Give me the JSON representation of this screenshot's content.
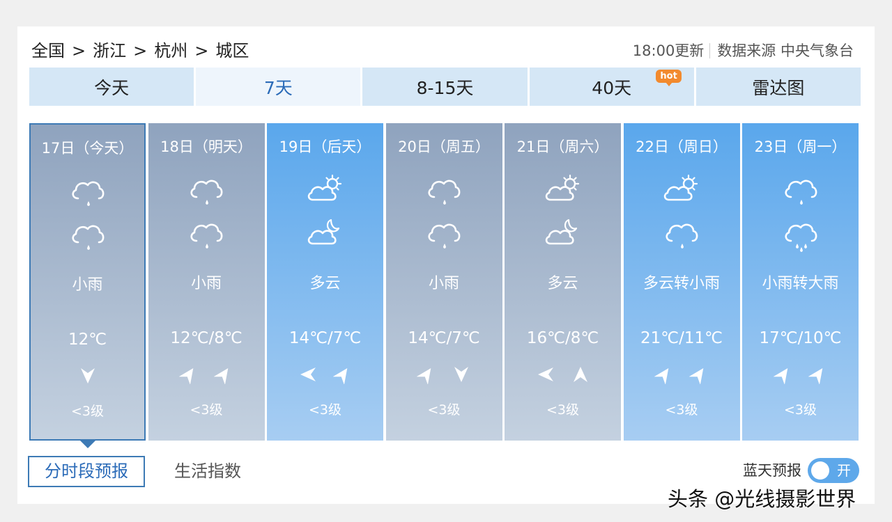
{
  "breadcrumb": {
    "items": [
      "全国",
      "浙江",
      "杭州",
      "城区"
    ],
    "separator": ">"
  },
  "update": {
    "time": "18:00更新",
    "source": "数据来源 中央气象台"
  },
  "tabs": [
    {
      "label": "今天"
    },
    {
      "label": "7天"
    },
    {
      "label": "8-15天"
    },
    {
      "label": "40天",
      "badge": "hot"
    },
    {
      "label": "雷达图"
    }
  ],
  "days": [
    {
      "title": "17日（今天）",
      "icon_day": "rain-cloud-icon",
      "icon_night": "rain-cloud-icon",
      "desc": "小雨",
      "temp": "12℃",
      "wind_icons": [
        "wind-arrow-down-icon"
      ],
      "level": "<3级",
      "style": "gray",
      "selected": true
    },
    {
      "title": "18日（明天）",
      "icon_day": "rain-cloud-icon",
      "icon_night": "rain-cloud-icon",
      "desc": "小雨",
      "temp": "12℃/8℃",
      "wind_icons": [
        "wind-arrow-northeast-icon",
        "wind-arrow-northeast-icon"
      ],
      "level": "<3级",
      "style": "gray"
    },
    {
      "title": "19日（后天）",
      "icon_day": "sun-cloud-icon",
      "icon_night": "moon-cloud-icon",
      "desc": "多云",
      "temp": "14℃/7℃",
      "wind_icons": [
        "wind-arrow-left-icon",
        "wind-arrow-northeast-icon"
      ],
      "level": "<3级",
      "style": "blue"
    },
    {
      "title": "20日（周五）",
      "icon_day": "rain-cloud-icon",
      "icon_night": "rain-cloud-icon",
      "desc": "小雨",
      "temp": "14℃/7℃",
      "wind_icons": [
        "wind-arrow-northeast-icon",
        "wind-arrow-down-icon"
      ],
      "level": "<3级",
      "style": "gray"
    },
    {
      "title": "21日（周六）",
      "icon_day": "sun-cloud-icon",
      "icon_night": "moon-cloud-icon",
      "desc": "多云",
      "temp": "16℃/8℃",
      "wind_icons": [
        "wind-arrow-left-icon",
        "wind-arrow-up-icon"
      ],
      "level": "<3级",
      "style": "gray"
    },
    {
      "title": "22日（周日）",
      "icon_day": "sun-cloud-icon",
      "icon_night": "rain-cloud-icon",
      "desc": "多云转小雨",
      "temp": "21℃/11℃",
      "wind_icons": [
        "wind-arrow-northeast-icon",
        "wind-arrow-northeast-icon"
      ],
      "level": "<3级",
      "style": "blue"
    },
    {
      "title": "23日（周一）",
      "icon_day": "rain-cloud-icon",
      "icon_night": "heavy-rain-cloud-icon",
      "desc": "小雨转大雨",
      "temp": "17℃/10℃",
      "wind_icons": [
        "wind-arrow-northeast-icon",
        "wind-arrow-northeast-icon"
      ],
      "level": "<3级",
      "style": "blue"
    }
  ],
  "bottom": {
    "hourly_label": "分时段预报",
    "life_label": "生活指数",
    "blue_sky_label": "蓝天预报",
    "toggle_label": "开"
  },
  "watermark": "头条 @光线摄影世界",
  "colors": {
    "active_blue": "#2b6bb8",
    "tab_bg": "#d5e7f6",
    "hot_orange": "#f28a2e",
    "toggle_blue": "#5ea8ea"
  }
}
